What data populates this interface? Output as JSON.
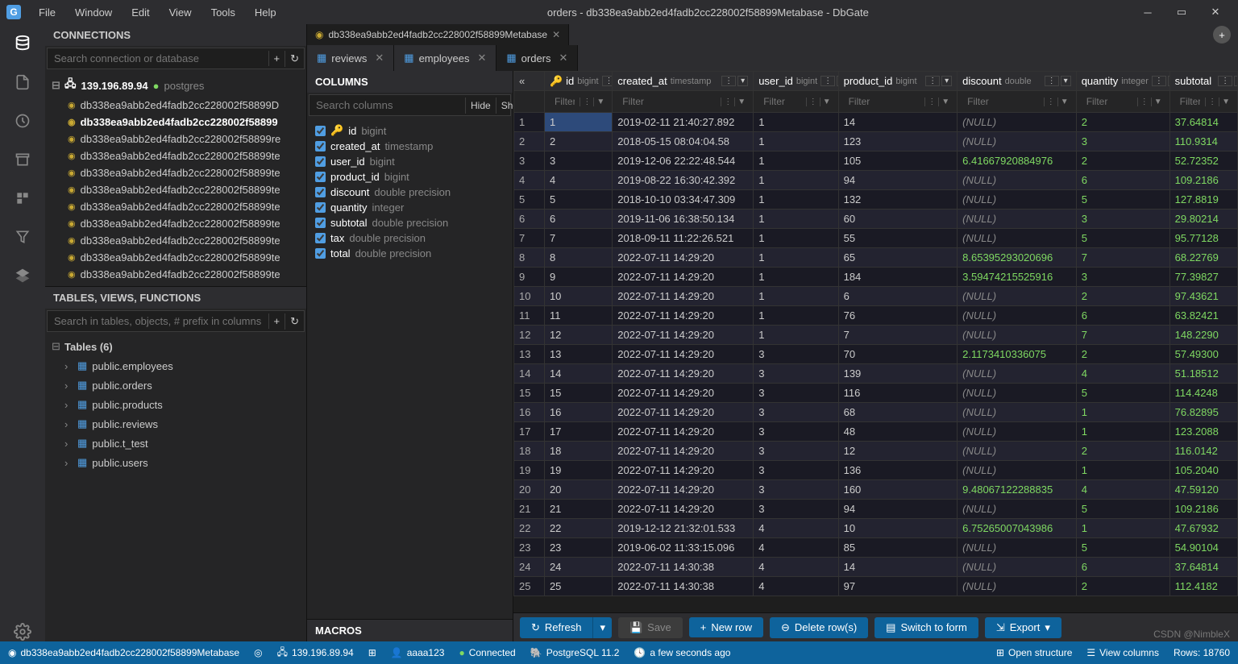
{
  "window": {
    "title": "orders - db338ea9abb2ed4fadb2cc228002f58899Metabase - DbGate",
    "menu": [
      "File",
      "Window",
      "Edit",
      "View",
      "Tools",
      "Help"
    ]
  },
  "sidebar": {
    "connections_header": "CONNECTIONS",
    "search_placeholder": "Search connection or database",
    "server": "139.196.89.94",
    "server_type": "postgres",
    "databases": [
      "db338ea9abb2ed4fadb2cc228002f58899D",
      "db338ea9abb2ed4fadb2cc228002f58899",
      "db338ea9abb2ed4fadb2cc228002f58899re",
      "db338ea9abb2ed4fadb2cc228002f58899te",
      "db338ea9abb2ed4fadb2cc228002f58899te",
      "db338ea9abb2ed4fadb2cc228002f58899te",
      "db338ea9abb2ed4fadb2cc228002f58899te",
      "db338ea9abb2ed4fadb2cc228002f58899te",
      "db338ea9abb2ed4fadb2cc228002f58899te",
      "db338ea9abb2ed4fadb2cc228002f58899te",
      "db338ea9abb2ed4fadb2cc228002f58899te"
    ],
    "active_db_index": 1,
    "tables_header": "TABLES, VIEWS, FUNCTIONS",
    "tables_search_placeholder": "Search in tables, objects, # prefix in columns",
    "tables_group": "Tables (6)",
    "tables": [
      "public.employees",
      "public.orders",
      "public.products",
      "public.reviews",
      "public.t_test",
      "public.users"
    ]
  },
  "db_tab": {
    "label": "db338ea9abb2ed4fadb2cc228002f58899Metabase"
  },
  "obj_tabs": [
    {
      "label": "reviews",
      "active": false
    },
    {
      "label": "employees",
      "active": false
    },
    {
      "label": "orders",
      "active": true
    }
  ],
  "columns_panel": {
    "header": "COLUMNS",
    "search_placeholder": "Search columns",
    "hide": "Hide",
    "show": "Show",
    "columns": [
      {
        "name": "id",
        "type": "bigint",
        "pk": true
      },
      {
        "name": "created_at",
        "type": "timestamp"
      },
      {
        "name": "user_id",
        "type": "bigint"
      },
      {
        "name": "product_id",
        "type": "bigint"
      },
      {
        "name": "discount",
        "type": "double precision"
      },
      {
        "name": "quantity",
        "type": "integer"
      },
      {
        "name": "subtotal",
        "type": "double precision"
      },
      {
        "name": "tax",
        "type": "double precision"
      },
      {
        "name": "total",
        "type": "double precision"
      }
    ],
    "macros": "MACROS"
  },
  "grid": {
    "headers": [
      {
        "name": "id",
        "type": "bigint",
        "pk": true
      },
      {
        "name": "created_at",
        "type": "timestamp"
      },
      {
        "name": "user_id",
        "type": "bigint"
      },
      {
        "name": "product_id",
        "type": "bigint"
      },
      {
        "name": "discount",
        "type": "double"
      },
      {
        "name": "quantity",
        "type": "integer"
      },
      {
        "name": "subtotal",
        "type": ""
      }
    ],
    "filter_placeholder": "Filter",
    "rows": [
      {
        "n": 1,
        "id": "1",
        "created_at": "2019-02-11 21:40:27.892",
        "user_id": "1",
        "product_id": "14",
        "discount": null,
        "quantity": "2",
        "subtotal": "37.64814"
      },
      {
        "n": 2,
        "id": "2",
        "created_at": "2018-05-15 08:04:04.58",
        "user_id": "1",
        "product_id": "123",
        "discount": null,
        "quantity": "3",
        "subtotal": "110.9314"
      },
      {
        "n": 3,
        "id": "3",
        "created_at": "2019-12-06 22:22:48.544",
        "user_id": "1",
        "product_id": "105",
        "discount": "6.41667920884976",
        "quantity": "2",
        "subtotal": "52.72352"
      },
      {
        "n": 4,
        "id": "4",
        "created_at": "2019-08-22 16:30:42.392",
        "user_id": "1",
        "product_id": "94",
        "discount": null,
        "quantity": "6",
        "subtotal": "109.2186"
      },
      {
        "n": 5,
        "id": "5",
        "created_at": "2018-10-10 03:34:47.309",
        "user_id": "1",
        "product_id": "132",
        "discount": null,
        "quantity": "5",
        "subtotal": "127.8819"
      },
      {
        "n": 6,
        "id": "6",
        "created_at": "2019-11-06 16:38:50.134",
        "user_id": "1",
        "product_id": "60",
        "discount": null,
        "quantity": "3",
        "subtotal": "29.80214"
      },
      {
        "n": 7,
        "id": "7",
        "created_at": "2018-09-11 11:22:26.521",
        "user_id": "1",
        "product_id": "55",
        "discount": null,
        "quantity": "5",
        "subtotal": "95.77128"
      },
      {
        "n": 8,
        "id": "8",
        "created_at": "2022-07-11 14:29:20",
        "user_id": "1",
        "product_id": "65",
        "discount": "8.65395293020696",
        "quantity": "7",
        "subtotal": "68.22769"
      },
      {
        "n": 9,
        "id": "9",
        "created_at": "2022-07-11 14:29:20",
        "user_id": "1",
        "product_id": "184",
        "discount": "3.59474215525916",
        "quantity": "3",
        "subtotal": "77.39827"
      },
      {
        "n": 10,
        "id": "10",
        "created_at": "2022-07-11 14:29:20",
        "user_id": "1",
        "product_id": "6",
        "discount": null,
        "quantity": "2",
        "subtotal": "97.43621"
      },
      {
        "n": 11,
        "id": "11",
        "created_at": "2022-07-11 14:29:20",
        "user_id": "1",
        "product_id": "76",
        "discount": null,
        "quantity": "6",
        "subtotal": "63.82421"
      },
      {
        "n": 12,
        "id": "12",
        "created_at": "2022-07-11 14:29:20",
        "user_id": "1",
        "product_id": "7",
        "discount": null,
        "quantity": "7",
        "subtotal": "148.2290"
      },
      {
        "n": 13,
        "id": "13",
        "created_at": "2022-07-11 14:29:20",
        "user_id": "3",
        "product_id": "70",
        "discount": "2.1173410336075",
        "quantity": "2",
        "subtotal": "57.49300"
      },
      {
        "n": 14,
        "id": "14",
        "created_at": "2022-07-11 14:29:20",
        "user_id": "3",
        "product_id": "139",
        "discount": null,
        "quantity": "4",
        "subtotal": "51.18512"
      },
      {
        "n": 15,
        "id": "15",
        "created_at": "2022-07-11 14:29:20",
        "user_id": "3",
        "product_id": "116",
        "discount": null,
        "quantity": "5",
        "subtotal": "114.4248"
      },
      {
        "n": 16,
        "id": "16",
        "created_at": "2022-07-11 14:29:20",
        "user_id": "3",
        "product_id": "68",
        "discount": null,
        "quantity": "1",
        "subtotal": "76.82895"
      },
      {
        "n": 17,
        "id": "17",
        "created_at": "2022-07-11 14:29:20",
        "user_id": "3",
        "product_id": "48",
        "discount": null,
        "quantity": "1",
        "subtotal": "123.2088"
      },
      {
        "n": 18,
        "id": "18",
        "created_at": "2022-07-11 14:29:20",
        "user_id": "3",
        "product_id": "12",
        "discount": null,
        "quantity": "2",
        "subtotal": "116.0142"
      },
      {
        "n": 19,
        "id": "19",
        "created_at": "2022-07-11 14:29:20",
        "user_id": "3",
        "product_id": "136",
        "discount": null,
        "quantity": "1",
        "subtotal": "105.2040"
      },
      {
        "n": 20,
        "id": "20",
        "created_at": "2022-07-11 14:29:20",
        "user_id": "3",
        "product_id": "160",
        "discount": "9.48067122288835",
        "quantity": "4",
        "subtotal": "47.59120"
      },
      {
        "n": 21,
        "id": "21",
        "created_at": "2022-07-11 14:29:20",
        "user_id": "3",
        "product_id": "94",
        "discount": null,
        "quantity": "5",
        "subtotal": "109.2186"
      },
      {
        "n": 22,
        "id": "22",
        "created_at": "2019-12-12 21:32:01.533",
        "user_id": "4",
        "product_id": "10",
        "discount": "6.75265007043986",
        "quantity": "1",
        "subtotal": "47.67932"
      },
      {
        "n": 23,
        "id": "23",
        "created_at": "2019-06-02 11:33:15.096",
        "user_id": "4",
        "product_id": "85",
        "discount": null,
        "quantity": "5",
        "subtotal": "54.90104"
      },
      {
        "n": 24,
        "id": "24",
        "created_at": "2022-07-11 14:30:38",
        "user_id": "4",
        "product_id": "14",
        "discount": null,
        "quantity": "6",
        "subtotal": "37.64814"
      },
      {
        "n": 25,
        "id": "25",
        "created_at": "2022-07-11 14:30:38",
        "user_id": "4",
        "product_id": "97",
        "discount": null,
        "quantity": "2",
        "subtotal": "112.4182"
      }
    ]
  },
  "toolbar": {
    "refresh": "Refresh",
    "save": "Save",
    "new_row": "New row",
    "delete_rows": "Delete row(s)",
    "switch_form": "Switch to form",
    "export": "Export"
  },
  "statusbar": {
    "db": "db338ea9abb2ed4fadb2cc228002f58899Metabase",
    "server": "139.196.89.94",
    "user": "aaaa123",
    "connected": "Connected",
    "engine": "PostgreSQL 11.2",
    "ago": "a few seconds ago",
    "open_structure": "Open structure",
    "view_columns": "View columns",
    "rows": "Rows: 18760"
  },
  "watermark": "CSDN @NimbleX"
}
